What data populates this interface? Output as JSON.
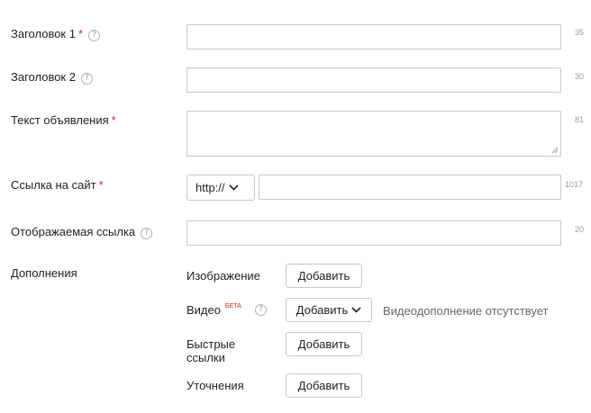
{
  "form": {
    "title1": {
      "label": "Заголовок 1",
      "required_mark": "*",
      "help_icon": "question-circle-icon",
      "help_glyph": "?",
      "counter": "35",
      "value": ""
    },
    "title2": {
      "label": "Заголовок 2",
      "help_icon": "question-circle-icon",
      "help_glyph": "?",
      "counter": "30",
      "value": ""
    },
    "ad_text": {
      "label": "Текст объявления",
      "required_mark": "*",
      "counter": "81",
      "value": ""
    },
    "site_link": {
      "label": "Ссылка на сайт",
      "required_mark": "*",
      "protocol": "http://",
      "counter": "1017",
      "value": ""
    },
    "display_link": {
      "label": "Отображаемая ссылка",
      "help_icon": "question-circle-icon",
      "help_glyph": "?",
      "counter": "20",
      "value": ""
    },
    "extensions": {
      "label": "Дополнения",
      "image": {
        "label": "Изображение",
        "button": "Добавить"
      },
      "video": {
        "label": "Видео",
        "beta": "БЕТА",
        "help_glyph": "?",
        "button": "Добавить",
        "status": "Видеодополнение отсутствует"
      },
      "quick_links": {
        "label_line1": "Быстрые",
        "label_line2": "ссылки",
        "button": "Добавить"
      },
      "callouts": {
        "label": "Уточнения",
        "button": "Добавить"
      }
    }
  },
  "colors": {
    "required": "#e02020",
    "border": "#c8c8c8",
    "counter": "#999999"
  }
}
